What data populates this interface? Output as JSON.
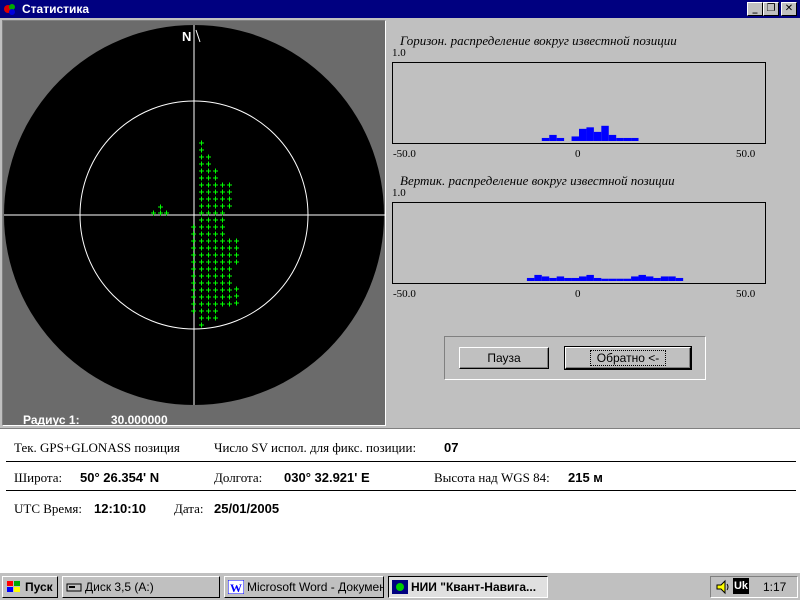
{
  "window": {
    "title": "Статистика",
    "controls": {
      "minimize": "_",
      "maximize": "❐",
      "close": "✕"
    }
  },
  "skyplot": {
    "north_label": "N",
    "radius_label": "Радиус 1:",
    "radius_value": "30.000000",
    "colors": {
      "background": "#000000",
      "circles": "#ffffff",
      "points": "#00ff00"
    }
  },
  "histograms": [
    {
      "title": "Горизон. распределение вокруг известной позиции",
      "ymax_label": "1.0",
      "x_ticks": [
        "-50.0",
        "0",
        "50.0"
      ]
    },
    {
      "title": "Вертик. распределение вокруг известной позиции",
      "ymax_label": "1.0",
      "x_ticks": [
        "-50.0",
        "0",
        "50.0"
      ]
    }
  ],
  "chart_data": [
    {
      "type": "bar",
      "title": "Горизон. распределение вокруг известной позиции",
      "xlim": [
        -50,
        50
      ],
      "ylim": [
        0,
        1
      ],
      "bar_width": 2,
      "bars": [
        {
          "x": -9,
          "y": 0.04
        },
        {
          "x": -7,
          "y": 0.08
        },
        {
          "x": -5,
          "y": 0.04
        },
        {
          "x": -1,
          "y": 0.06
        },
        {
          "x": 1,
          "y": 0.16
        },
        {
          "x": 3,
          "y": 0.18
        },
        {
          "x": 5,
          "y": 0.12
        },
        {
          "x": 7,
          "y": 0.2
        },
        {
          "x": 9,
          "y": 0.08
        },
        {
          "x": 11,
          "y": 0.04
        },
        {
          "x": 13,
          "y": 0.04
        },
        {
          "x": 15,
          "y": 0.04
        }
      ],
      "color": "#0000ff"
    },
    {
      "type": "bar",
      "title": "Вертик. распределение вокруг известной позиции",
      "xlim": [
        -50,
        50
      ],
      "ylim": [
        0,
        1
      ],
      "bar_width": 2,
      "bars": [
        {
          "x": -13,
          "y": 0.04
        },
        {
          "x": -11,
          "y": 0.08
        },
        {
          "x": -9,
          "y": 0.06
        },
        {
          "x": -7,
          "y": 0.04
        },
        {
          "x": -5,
          "y": 0.06
        },
        {
          "x": -3,
          "y": 0.04
        },
        {
          "x": -1,
          "y": 0.04
        },
        {
          "x": 1,
          "y": 0.06
        },
        {
          "x": 3,
          "y": 0.08
        },
        {
          "x": 5,
          "y": 0.04
        },
        {
          "x": 7,
          "y": 0.03
        },
        {
          "x": 9,
          "y": 0.03
        },
        {
          "x": 11,
          "y": 0.03
        },
        {
          "x": 13,
          "y": 0.03
        },
        {
          "x": 15,
          "y": 0.06
        },
        {
          "x": 17,
          "y": 0.08
        },
        {
          "x": 19,
          "y": 0.06
        },
        {
          "x": 21,
          "y": 0.04
        },
        {
          "x": 23,
          "y": 0.06
        },
        {
          "x": 25,
          "y": 0.06
        },
        {
          "x": 27,
          "y": 0.04
        }
      ],
      "color": "#0000ff"
    }
  ],
  "buttons": {
    "pause": "Пауза",
    "back": "Обратно <-"
  },
  "info": {
    "position_label": "Тек. GPS+GLONASS позиция",
    "sv_label": "Число  SV испол. для фикс. позиции:",
    "sv_value": "07",
    "lat_label": "Широта:",
    "lat_value": "50° 26.354' N",
    "lon_label": "Долгота:",
    "lon_value": "030° 32.921' E",
    "alt_label": "Высота над WGS 84:",
    "alt_value": "215 м",
    "utc_label": "UTC Время:",
    "utc_value": "12:10:10",
    "date_label": "Дата:",
    "date_value": "25/01/2005"
  },
  "taskbar": {
    "start": "Пуск",
    "tasks": [
      {
        "label": "Диск 3,5 (A:)"
      },
      {
        "label": "Microsoft Word - Докумен..."
      },
      {
        "label": "НИИ \"Квант-Навига..."
      }
    ],
    "tray_lang": "Uk",
    "clock": "1:17"
  }
}
